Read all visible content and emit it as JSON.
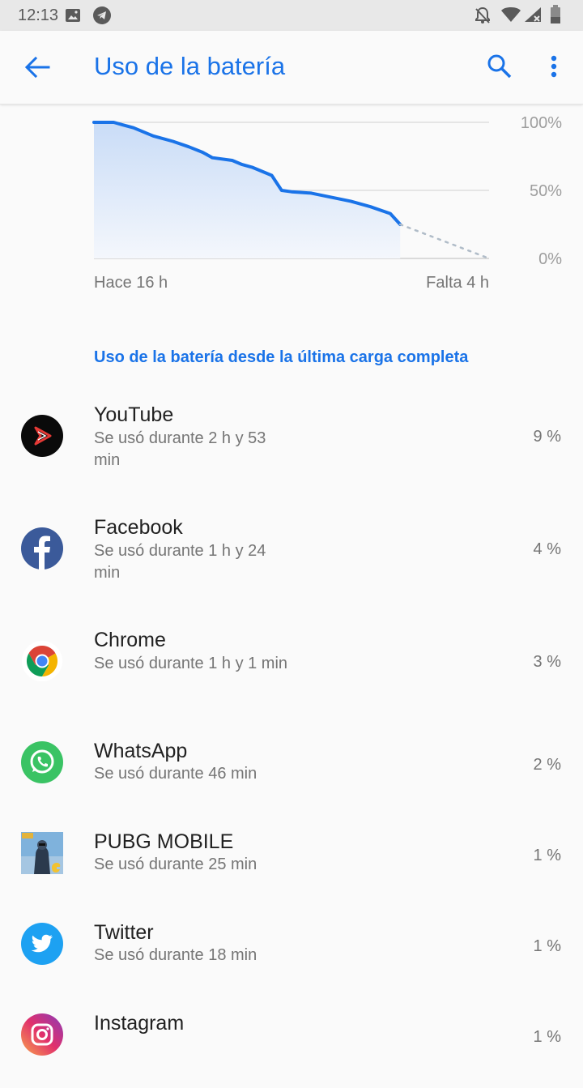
{
  "status_bar": {
    "time": "12:13",
    "icons": [
      "image-icon",
      "telegram-icon",
      "notifications-off-icon",
      "wifi-icon",
      "signal-icon",
      "battery-icon"
    ]
  },
  "app_bar": {
    "title": "Uso de la batería",
    "icons": [
      "back-arrow-icon",
      "search-icon",
      "more-vert-icon"
    ],
    "accent_color": "#1a73e8"
  },
  "chart_data": {
    "type": "area",
    "title": "",
    "xlabel": "",
    "ylabel": "",
    "y_tick_labels": [
      "100%",
      "50%",
      "0%"
    ],
    "ylim": [
      0,
      100
    ],
    "x_labels": [
      "Hace 16 h",
      "Falta 4 h"
    ],
    "series": [
      {
        "x": [
          0,
          0.5,
          1,
          1.5,
          2,
          3,
          4,
          4.8,
          5.5,
          6,
          7,
          7.5,
          8,
          9,
          9.5,
          10,
          11,
          12,
          13,
          14,
          15,
          15.5
        ],
        "y": [
          100,
          100,
          100,
          98,
          96,
          90,
          86,
          82,
          78,
          74,
          72,
          69,
          67,
          61,
          50,
          49,
          48,
          45,
          42,
          38,
          33,
          25
        ]
      }
    ],
    "projection": {
      "x": [
        15.5,
        20
      ],
      "y": [
        25,
        0
      ]
    },
    "line_color": "#1a73e8",
    "grid": true
  },
  "section_header": "Uso de la batería desde la última carga completa",
  "apps": [
    {
      "name": "YouTube",
      "usage": "Se usó durante 2 h y 53 min",
      "percent": "9 %",
      "icon": "youtube-vanced-icon"
    },
    {
      "name": "Facebook",
      "usage": "Se usó durante 1 h y 24 min",
      "percent": "4 %",
      "icon": "facebook-icon"
    },
    {
      "name": "Chrome",
      "usage": "Se usó durante 1 h y 1 min",
      "percent": "3 %",
      "icon": "chrome-icon"
    },
    {
      "name": "WhatsApp",
      "usage": "Se usó durante 46 min",
      "percent": "2 %",
      "icon": "whatsapp-icon"
    },
    {
      "name": "PUBG MOBILE",
      "usage": "Se usó durante 25 min",
      "percent": "1 %",
      "icon": "pubg-icon"
    },
    {
      "name": "Twitter",
      "usage": "Se usó durante 18 min",
      "percent": "1 %",
      "icon": "twitter-icon"
    },
    {
      "name": "Instagram",
      "usage": "",
      "percent": "1 %",
      "icon": "instagram-icon"
    }
  ]
}
